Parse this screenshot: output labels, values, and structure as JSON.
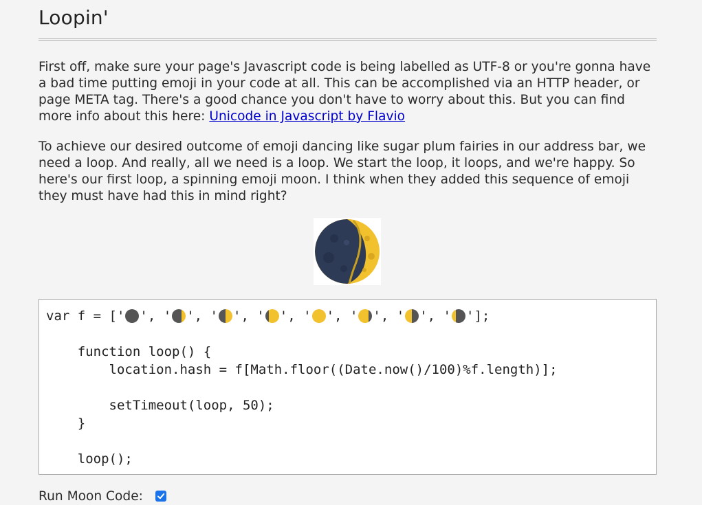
{
  "article": {
    "title": "Loopin'",
    "paragraph1_text": "First off, make sure your page's Javascript code is being labelled as UTF-8 or you're gonna have a bad time putting emoji in your code at all. This can be accomplished via an HTTP header, or page META tag. There's a good chance you don't have to worry about this. But you can find more info about this here: ",
    "paragraph1_link": "Unicode in Javascript by Flavio",
    "paragraph2_text": "To achieve our desired outcome of emoji dancing like sugar plum fairies in our address bar, we need a loop. And really, all we need is a loop. We start the loop, it loops, and we're happy. So here's our first loop, a spinning emoji moon. I think when they added this sequence of emoji they must have had this in mind right?"
  },
  "moon_image": {
    "icon": "waxing-gibbous-moon-icon",
    "colors": {
      "dark": "#2e3b57",
      "light": "#f2c12e"
    }
  },
  "code": {
    "line1_prefix": "var f = [",
    "line1_suffix": "];",
    "moons": [
      "🌑",
      "🌒",
      "🌓",
      "🌔",
      "🌝",
      "🌖",
      "🌗",
      "🌘"
    ],
    "line2": "    function loop() {",
    "line3": "        location.hash = f[Math.floor((Date.now()/100)%f.length)];",
    "line4": "        setTimeout(loop, 50);",
    "line5": "    }",
    "line6": "    loop();"
  },
  "controls": {
    "run_label": "Run Moon Code:",
    "run_checked": true,
    "accent": "#1a73e8"
  }
}
